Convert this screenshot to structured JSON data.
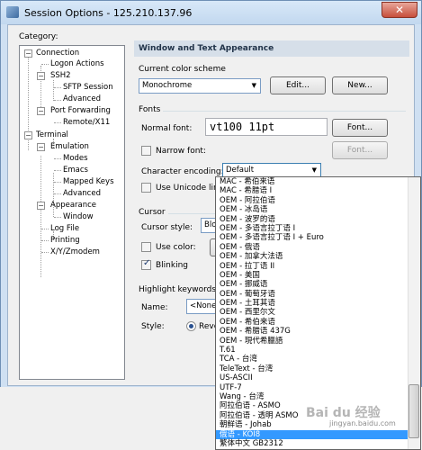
{
  "window": {
    "title": "Session Options - 125.210.137.96",
    "close_glyph": "✕"
  },
  "category": {
    "label": "Category:",
    "tree": [
      "Connection",
      "Logon Actions",
      "SSH2",
      "SFTP Session",
      "Advanced",
      "Port Forwarding",
      "Remote/X11",
      "Terminal",
      "Emulation",
      "Modes",
      "Emacs",
      "Mapped Keys",
      "Advanced",
      "Appearance",
      "Window",
      "Log File",
      "Printing",
      "X/Y/Zmodem"
    ]
  },
  "panel": {
    "header": "Window and Text Appearance",
    "color_scheme": {
      "label": "Current color scheme",
      "value": "Monochrome",
      "edit_button": "Edit...",
      "new_button": "New..."
    },
    "fonts": {
      "label": "Fonts",
      "normal_font_label": "Normal font:",
      "normal_font_value": "vt100 11pt",
      "font_button": "Font...",
      "narrow_font_label": "Narrow font:",
      "font_button_disabled": "Font...",
      "char_encoding_label": "Character encoding:",
      "char_encoding_value": "Default",
      "unicode_line_label": "Use Unicode line-dr"
    },
    "cursor": {
      "label": "Cursor",
      "style_label": "Cursor style:",
      "style_value": "Bloc",
      "use_color_label": "Use color:",
      "blinking_label": "Blinking"
    },
    "highlight": {
      "label": "Highlight keywords",
      "name_label": "Name:",
      "name_value": "<None>",
      "style_label": "Style:",
      "style_value": "Reverse"
    }
  },
  "encoding_dropdown": [
    "MAC - 希伯来语",
    "MAC - 希腊语 I",
    "OEM - 阿拉伯语",
    "OEM - 冰岛语",
    "OEM - 波罗的语",
    "OEM - 多语言拉丁语 I",
    "OEM - 多语言拉丁语 I + Euro",
    "OEM - 俄语",
    "OEM - 加拿大法语",
    "OEM - 拉丁语 II",
    "OEM - 美国",
    "OEM - 挪威语",
    "OEM - 葡萄牙语",
    "OEM - 土耳其语",
    "OEM - 西里尔文",
    "OEM - 希伯来语",
    "OEM - 希腊语 437G",
    "OEM - 現代希臘語",
    "T.61",
    "TCA - 台湾",
    "TeleText - 台湾",
    "US-ASCII",
    "UTF-7",
    "Wang - 台湾",
    "阿拉伯语 - ASMO",
    "阿拉伯语 - 透明 ASMO",
    "朝鲜语 - Johab",
    "俄语 - KOI8",
    "繁体中文 GB2312"
  ],
  "selected_encoding_index": 27,
  "watermark": {
    "brand": "Bai du 经验",
    "url": "jingyan.baidu.com"
  },
  "colors": {
    "selection": "#3399ff",
    "titlebar": "#cfe0f2"
  }
}
